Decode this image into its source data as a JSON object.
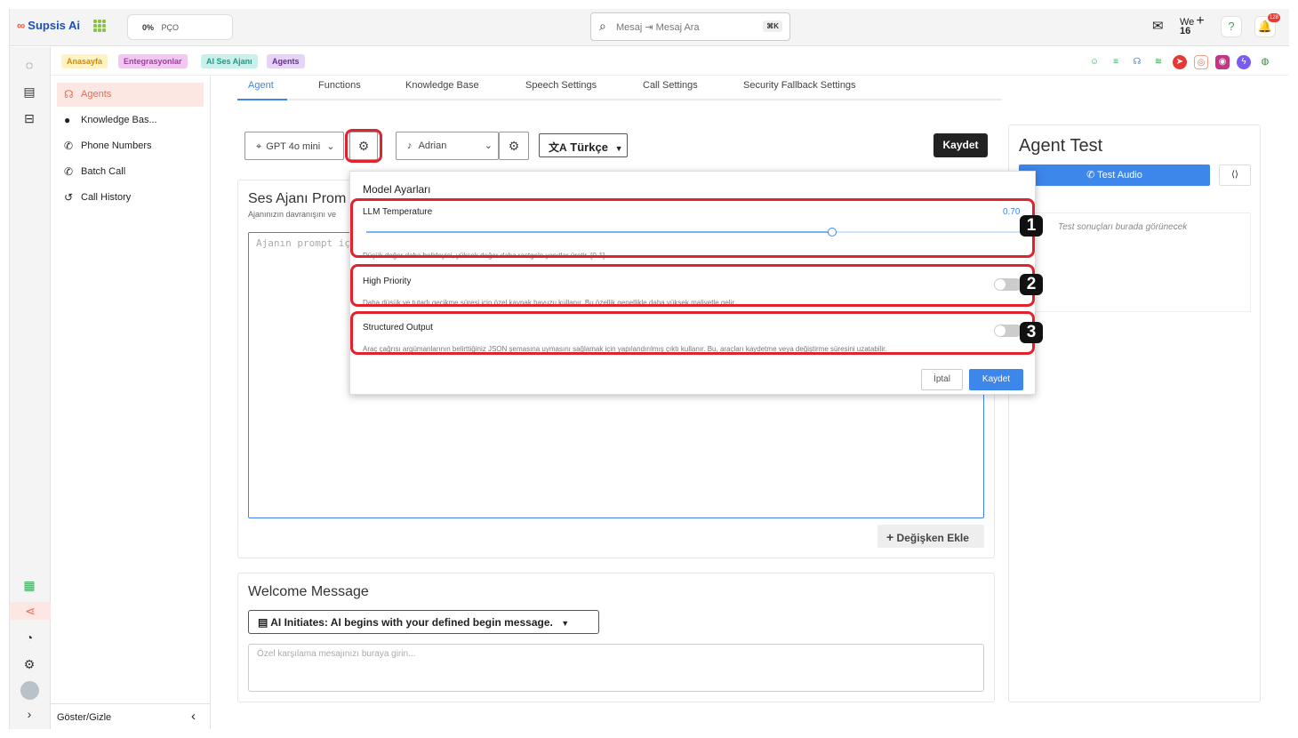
{
  "topbar": {
    "brand": "Supsis Ai",
    "percent": "0%",
    "percent_label": "PÇO",
    "search_placeholder": "Mesaj ⇥ Mesaj Ara",
    "search_shortcut": "⌘K",
    "week_label": "We",
    "week_number": "16",
    "notification_count": "128"
  },
  "breadcrumbs": [
    "Anasayfa",
    "Entegrasyonlar",
    "AI Ses Ajanı",
    "Agents"
  ],
  "sidebar": {
    "items": [
      "Agents",
      "Knowledge Bas...",
      "Phone Numbers",
      "Batch Call",
      "Call History"
    ],
    "footer_label": "Göster/Gizle"
  },
  "tabs": [
    "Agent",
    "Functions",
    "Knowledge Base",
    "Speech Settings",
    "Call Settings",
    "Security Fallback Settings"
  ],
  "toolbar": {
    "model": "GPT 4o mini",
    "voice": "Adrian",
    "language": "Türkçe",
    "save_label": "Kaydet"
  },
  "prompt_card": {
    "title": "Ses Ajanı Prom",
    "subtitle": "Ajanınızın davranışını ve",
    "placeholder": "Ajanın prompt içe",
    "add_variable_label": "Değişken Ekle"
  },
  "welcome": {
    "title": "Welcome Message",
    "mode": "AI Initiates: AI begins with your defined begin message.",
    "placeholder": "Özel karşılama mesajınızı buraya girin..."
  },
  "agent_test": {
    "title": "Agent Test",
    "test_audio_label": "Test Audio",
    "results_placeholder": "Test sonuçları burada görünecek"
  },
  "model_settings": {
    "title": "Model Ayarları",
    "temperature": {
      "label": "LLM Temperature",
      "value": "0.70",
      "value_fraction": 0.7,
      "hint": "Düşük değer daha belirleyici, yüksek değer daha rastgele yanıtlar üretir. [0-1]"
    },
    "high_priority": {
      "label": "High Priority",
      "enabled": false,
      "hint": "Daha düşük ve tutarlı gecikme süresi için özel kaynak havuzu kullanır. Bu özellik genellikle daha yüksek maliyetle gelir."
    },
    "structured_output": {
      "label": "Structured Output",
      "enabled": false,
      "hint": "Araç çağrısı argümanlarının belirttiğiniz JSON şemasına uymasını sağlamak için yapılandırılmış çıktı kullanır. Bu, araçları kaydetme veya değiştirme süresini uzatabilir."
    },
    "cancel_label": "İptal",
    "save_label": "Kaydet"
  },
  "annotations": [
    "1",
    "2",
    "3"
  ],
  "colors": {
    "accent": "#3d86ea",
    "active_sidebar": "#e96b54",
    "annotation_red": "#e0232d"
  }
}
